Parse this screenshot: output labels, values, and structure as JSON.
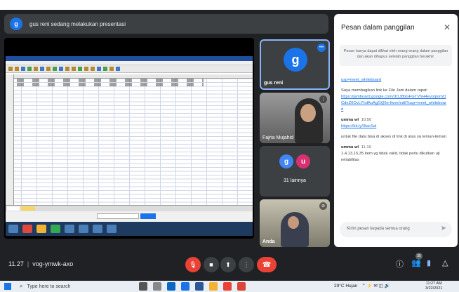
{
  "banner": {
    "avatar_letter": "g",
    "text": "gus reni sedang melakukan presentasi"
  },
  "tiles": {
    "presenter": {
      "avatar_letter": "g",
      "name": "gus reni"
    },
    "participant_2": {
      "name": "Fajria Mujahid"
    },
    "others": {
      "avatar_1": "g",
      "avatar_2": "u",
      "label": "31 lainnya"
    },
    "self": {
      "name": "Anda"
    }
  },
  "chat": {
    "title": "Pesan dalam panggilan",
    "close_icon": "close-icon",
    "notice": "Pesan hanya dapat dilihat oleh orang-orang dalam panggilan dan akan dihapus setelah panggilan berakhir.",
    "messages": [
      {
        "link": "usp=meet_whiteboard"
      },
      {
        "text": "Saya membagikan link ke File Jam dalam rapat:",
        "link": "https://jamboard.google.com/d/1J8bGFGTVhH4evo/pomOCdeZ0OvLYhdAuAgf1Q6e-fwve/edit?usp=meet_whiteboard"
      },
      {
        "sender": "ummu wl",
        "time": "10.50",
        "link": "https://bit.ly/3tacSal"
      },
      {
        "text": "untuk file data bisa di akses di link di atas ya teman-teman"
      },
      {
        "sender": "ummu wl",
        "time": "11.10",
        "text": "1,4,13,15,35 item yg tidak valid, tidak perlu dikutkan uji reliabilitas"
      }
    ],
    "input_placeholder": "Kirim pesan kepada semua orang"
  },
  "meeting": {
    "time": "11.27",
    "code": "vog-ymwk-axo",
    "participant_count": "35"
  },
  "taskbar": {
    "search_placeholder": "Type here to search",
    "weather": "29°C Hujan",
    "time": "11:27 AM",
    "date": "3/22/2021"
  },
  "colors": {
    "meet_bg": "#202124",
    "accent": "#1a73e8",
    "end_call": "#ea4335"
  }
}
